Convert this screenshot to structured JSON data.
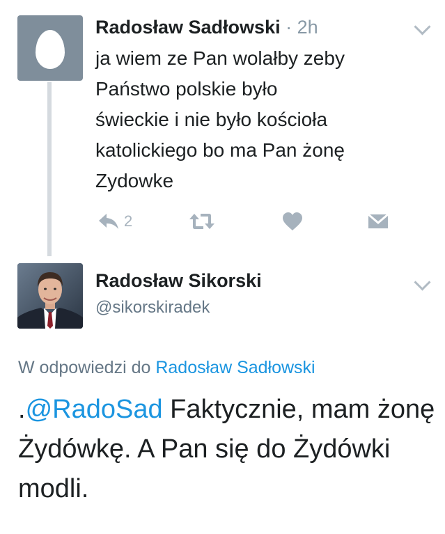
{
  "tweet_reply": {
    "author_name": "Radosław Sadłowski",
    "time_separator": "·",
    "time": "2h",
    "text": "ja wiem ze Pan wolałby zeby\nPaństwo polskie było\nświeckie i nie było kościoła\nkatolickiego bo ma Pan żonę\nZydowke",
    "reply_count": "2",
    "icons": [
      "reply-icon",
      "retweet-icon",
      "like-icon",
      "direct-message-icon",
      "chevron-down-icon"
    ]
  },
  "tweet_main": {
    "author_name": "Radosław Sikorski",
    "handle": "@sikorskiradek",
    "reply_context_prefix": "W odpowiedzi do",
    "reply_context_user": "Radosław Sadłowski",
    "text_lead": ".",
    "mention": "@RadoSad",
    "text_body": " Faktycznie, mam żonę Żydówkę.  A Pan się do Żydówki modli."
  },
  "colors": {
    "link_blue": "#1b95e0",
    "secondary_text": "#657786",
    "icon_gray": "#a6b2bd",
    "egg_avatar_bg": "#7f8e9b",
    "thread_line": "#d5dadf"
  }
}
